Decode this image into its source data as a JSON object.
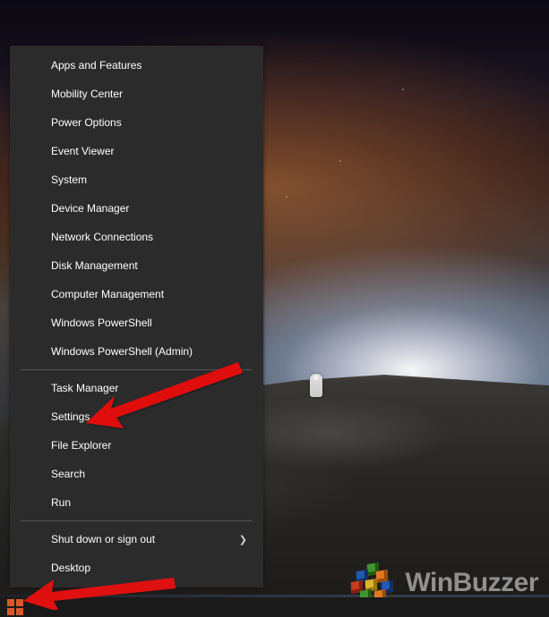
{
  "winx_menu": {
    "groups": [
      {
        "items": [
          {
            "label": "Apps and Features",
            "name": "menu-apps-and-features"
          },
          {
            "label": "Mobility Center",
            "name": "menu-mobility-center"
          },
          {
            "label": "Power Options",
            "name": "menu-power-options"
          },
          {
            "label": "Event Viewer",
            "name": "menu-event-viewer"
          },
          {
            "label": "System",
            "name": "menu-system"
          },
          {
            "label": "Device Manager",
            "name": "menu-device-manager"
          },
          {
            "label": "Network Connections",
            "name": "menu-network-connections"
          },
          {
            "label": "Disk Management",
            "name": "menu-disk-management"
          },
          {
            "label": "Computer Management",
            "name": "menu-computer-management"
          },
          {
            "label": "Windows PowerShell",
            "name": "menu-windows-powershell"
          },
          {
            "label": "Windows PowerShell (Admin)",
            "name": "menu-windows-powershell-admin"
          }
        ]
      },
      {
        "items": [
          {
            "label": "Task Manager",
            "name": "menu-task-manager"
          },
          {
            "label": "Settings",
            "name": "menu-settings"
          },
          {
            "label": "File Explorer",
            "name": "menu-file-explorer"
          },
          {
            "label": "Search",
            "name": "menu-search"
          },
          {
            "label": "Run",
            "name": "menu-run"
          }
        ]
      },
      {
        "items": [
          {
            "label": "Shut down or sign out",
            "name": "menu-shut-down-or-sign-out",
            "submenu": true
          },
          {
            "label": "Desktop",
            "name": "menu-desktop"
          }
        ]
      }
    ]
  },
  "watermark": {
    "text": "WinBuzzer"
  },
  "annotations": {
    "arrow_to_settings": true,
    "arrow_to_start": true
  }
}
